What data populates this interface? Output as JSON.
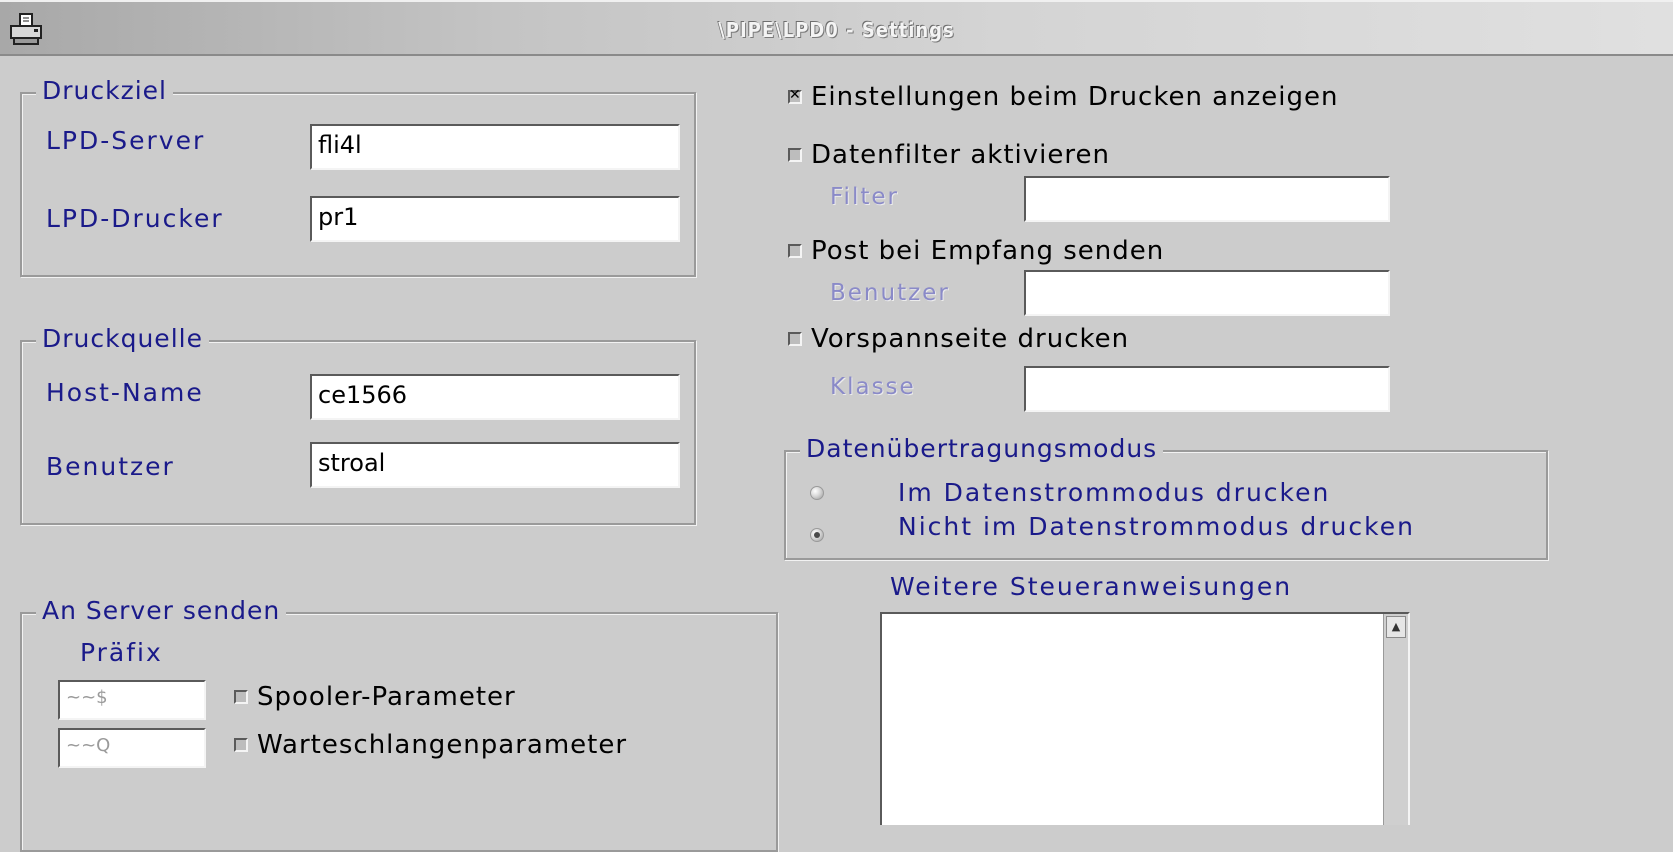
{
  "window": {
    "title": "\\PIPE\\LPD0 - Settings",
    "icon": "printer-icon"
  },
  "druckziel": {
    "title": "Druckziel",
    "server_label": "LPD-Server",
    "server_value": "fli4l",
    "printer_label": "LPD-Drucker",
    "printer_value": "pr1"
  },
  "druckquelle": {
    "title": "Druckquelle",
    "host_label": "Host-Name",
    "host_value": "ce1566",
    "user_label": "Benutzer",
    "user_value": "stroal"
  },
  "server_senden": {
    "title": "An Server senden",
    "prefix_label": "Präfix",
    "prefix1": "~~$",
    "prefix2": "~~Q",
    "spooler_label": "Spooler-Parameter",
    "spooler_checked": false,
    "queue_label": "Warteschlangenparameter",
    "queue_checked": false
  },
  "options": {
    "show_settings_label": "Einstellungen beim Drucken anzeigen",
    "show_settings_checked": true,
    "filter_enable_label": "Datenfilter aktivieren",
    "filter_enable_checked": false,
    "filter_label": "Filter",
    "filter_value": "",
    "mail_label": "Post bei Empfang senden",
    "mail_checked": false,
    "mail_user_label": "Benutzer",
    "mail_user_value": "",
    "banner_label": "Vorspannseite drucken",
    "banner_checked": false,
    "class_label": "Klasse",
    "class_value": ""
  },
  "transfer_mode": {
    "title": "Datenübertragungsmodus",
    "options": [
      {
        "label": "Im Datenstrommodus drucken",
        "selected": false
      },
      {
        "label": "Nicht im Datenstrommodus drucken",
        "selected": true
      }
    ]
  },
  "more_control": {
    "label": "Weitere Steueranweisungen",
    "value": ""
  }
}
